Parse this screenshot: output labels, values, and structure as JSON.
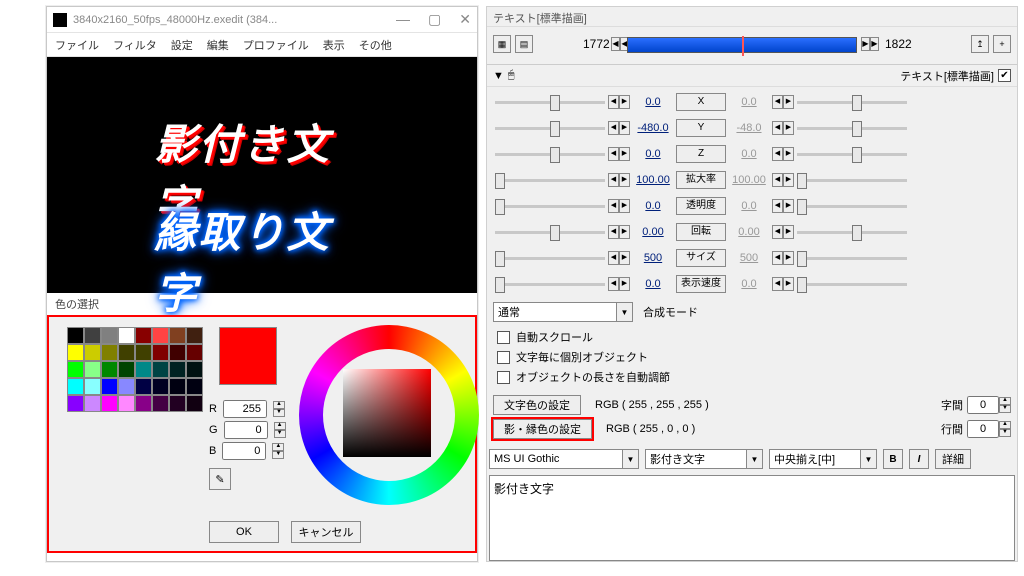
{
  "left": {
    "title": "3840x2160_50fps_48000Hz.exedit (384...",
    "winbtns": {
      "min": "—",
      "max": "▢",
      "close": "✕"
    },
    "menu": [
      "ファイル",
      "フィルタ",
      "設定",
      "編集",
      "プロファイル",
      "表示",
      "その他"
    ],
    "preview": {
      "text1": "影付き文字",
      "text2": "縁取り文字"
    },
    "colorpick": {
      "title": "色の選択",
      "palette": [
        "#000",
        "#404040",
        "#808080",
        "#fff",
        "#800",
        "#f44",
        "#804020",
        "#402010",
        "#ff0",
        "#cc0",
        "#808000",
        "#404000",
        "#404000",
        "#800000",
        "#400000",
        "#600",
        "#0f0",
        "#8f8",
        "#080",
        "#040",
        "#088",
        "#044",
        "#022",
        "#011",
        "#0ff",
        "#8ff",
        "#00f",
        "#88f",
        "#004",
        "#002",
        "#001",
        "#001",
        "#80f",
        "#c8f",
        "#f0f",
        "#f8f",
        "#808",
        "#404",
        "#202",
        "#101"
      ],
      "swatch": "#ff0000",
      "R": "255",
      "G": "0",
      "B": "0",
      "ok": "OK",
      "cancel": "キャンセル"
    }
  },
  "right": {
    "title": "テキスト[標準描画]",
    "frameL": "1772",
    "frameR": "1822",
    "subhead_label": "テキスト[標準描画]",
    "params": [
      {
        "name": "X",
        "valL": "0.0",
        "valR": "0.0",
        "sl": "l50"
      },
      {
        "name": "Y",
        "valL": "-480.0",
        "valR": "-48.0",
        "sl": "l50"
      },
      {
        "name": "Z",
        "valL": "0.0",
        "valR": "0.0",
        "sl": "l50"
      },
      {
        "name": "拡大率",
        "valL": "100.00",
        "valR": "100.00",
        "sl": "l0"
      },
      {
        "name": "透明度",
        "valL": "0.0",
        "valR": "0.0",
        "sl": "l0"
      },
      {
        "name": "回転",
        "valL": "0.00",
        "valR": "0.00",
        "sl": "l50"
      },
      {
        "name": "サイズ",
        "valL": "500",
        "valR": "500",
        "sl": "l0"
      },
      {
        "name": "表示速度",
        "valL": "0.0",
        "valR": "0.0",
        "sl": "l0"
      }
    ],
    "blend_mode": "通常",
    "blend_label": "合成モード",
    "checks": [
      "自動スクロール",
      "文字毎に個別オブジェクト",
      "オブジェクトの長さを自動調節"
    ],
    "cfg": {
      "text_color_btn": "文字色の設定",
      "text_color_val": "RGB ( 255 , 255 , 255 )",
      "shadow_btn": "影・縁色の設定",
      "shadow_val": "RGB ( 255 , 0 , 0 )",
      "char_space_label": "字間",
      "char_space_val": "0",
      "line_space_label": "行間",
      "line_space_val": "0"
    },
    "font": "MS UI Gothic",
    "style": "影付き文字",
    "align": "中央揃え[中]",
    "bold": "B",
    "italic": "I",
    "details": "詳細",
    "textarea": "影付き文字"
  }
}
